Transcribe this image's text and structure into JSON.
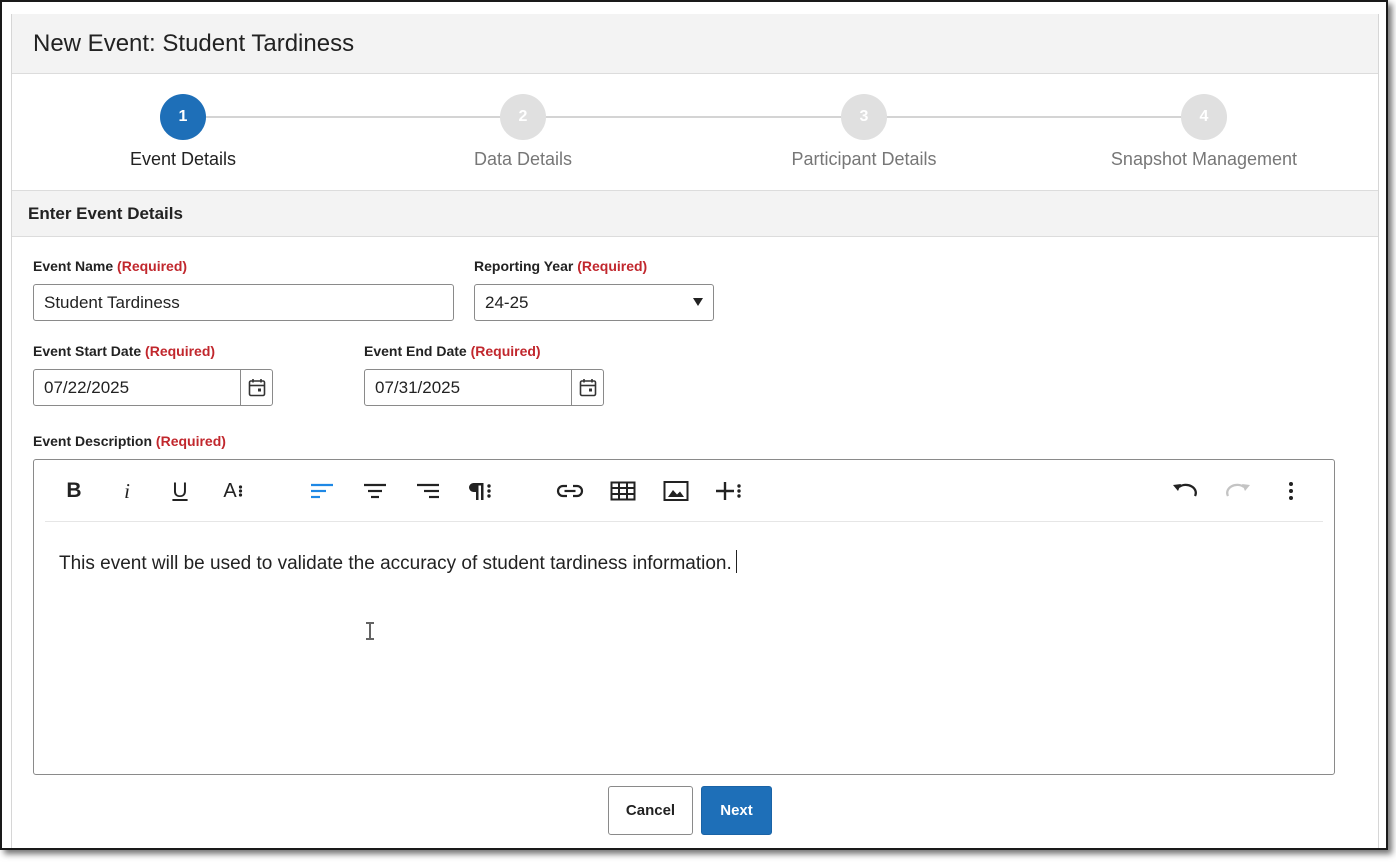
{
  "header": {
    "title": "New Event: Student Tardiness"
  },
  "stepper": {
    "steps": [
      {
        "number": "1",
        "label": "Event Details"
      },
      {
        "number": "2",
        "label": "Data Details"
      },
      {
        "number": "3",
        "label": "Participant Details"
      },
      {
        "number": "4",
        "label": "Snapshot Management"
      }
    ],
    "active_step": 1
  },
  "section": {
    "title": "Enter Event Details"
  },
  "form": {
    "required_text": "(Required)",
    "event_name": {
      "label": "Event Name",
      "value": "Student Tardiness"
    },
    "reporting_year": {
      "label": "Reporting Year",
      "value": "24-25"
    },
    "start_date": {
      "label": "Event Start Date",
      "value": "07/22/2025"
    },
    "end_date": {
      "label": "Event End Date",
      "value": "07/31/2025"
    },
    "description": {
      "label": "Event Description",
      "value": "This event will be used to validate the accuracy of student tardiness information."
    }
  },
  "toolbar": {
    "icons": [
      "bold-icon",
      "italic-icon",
      "underline-icon",
      "font-size-icon",
      "align-left-icon",
      "align-center-icon",
      "align-right-icon",
      "paragraph-format-icon",
      "link-icon",
      "table-icon",
      "image-icon",
      "insert-more-icon",
      "undo-icon",
      "redo-icon",
      "more-options-icon"
    ],
    "bold_glyph": "B",
    "italic_glyph": "i",
    "underline_glyph": "U",
    "font_glyph": "A",
    "active_color": "#1e88e5"
  },
  "footer": {
    "cancel_label": "Cancel",
    "next_label": "Next"
  },
  "colors": {
    "primary": "#1e6fb8",
    "required": "#c1272d",
    "inactive_step": "#e0e0e0"
  }
}
